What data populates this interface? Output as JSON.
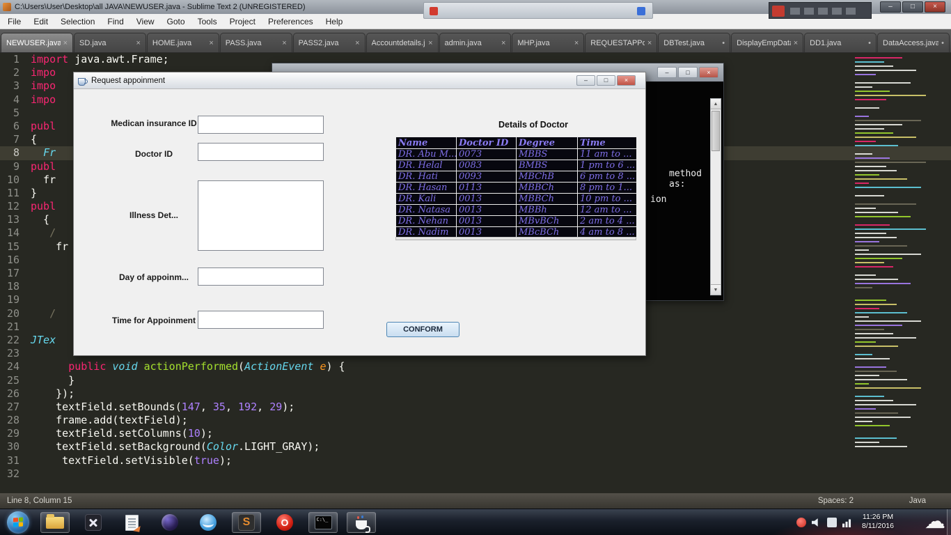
{
  "titlebar": {
    "title": "C:\\Users\\User\\Desktop\\all JAVA\\NEWUSER.java - Sublime Text 2 (UNREGISTERED)"
  },
  "glyphs": {
    "minimize": "–",
    "maximize": "□",
    "close": "×",
    "scroll_up": "▲",
    "scroll_down": "▼",
    "cloud": "☁"
  },
  "menubar": {
    "items": [
      "File",
      "Edit",
      "Selection",
      "Find",
      "View",
      "Goto",
      "Tools",
      "Project",
      "Preferences",
      "Help"
    ]
  },
  "tabs": [
    {
      "label": "NEWUSER.java",
      "indicator": "×",
      "active": true
    },
    {
      "label": "SD.java",
      "indicator": "×"
    },
    {
      "label": "HOME.java",
      "indicator": "×"
    },
    {
      "label": "PASS.java",
      "indicator": "×"
    },
    {
      "label": "PASS2.java",
      "indicator": "×"
    },
    {
      "label": "Accountdetails.jav",
      "indicator": "×"
    },
    {
      "label": "admin.java",
      "indicator": "×"
    },
    {
      "label": "MHP.java",
      "indicator": "×"
    },
    {
      "label": "REQUESTAPPoinm",
      "indicator": "×"
    },
    {
      "label": "DBTest.java",
      "indicator": "•"
    },
    {
      "label": "DisplayEmpData.j",
      "indicator": "×"
    },
    {
      "label": "DD1.java",
      "indicator": "•"
    },
    {
      "label": "DataAccess.java",
      "indicator": "•"
    }
  ],
  "editor": {
    "lines": [
      {
        "n": 1,
        "t": [
          [
            "kw",
            "import"
          ],
          [
            "pl",
            " java.awt.Frame;"
          ]
        ]
      },
      {
        "n": 2,
        "t": [
          [
            "kw",
            "impo"
          ]
        ]
      },
      {
        "n": 3,
        "t": [
          [
            "kw",
            "impo"
          ]
        ]
      },
      {
        "n": 4,
        "t": [
          [
            "kw",
            "impo"
          ]
        ]
      },
      {
        "n": 5,
        "t": []
      },
      {
        "n": 6,
        "t": [
          [
            "kw",
            "publ"
          ]
        ]
      },
      {
        "n": 7,
        "t": [
          [
            "pl",
            "{"
          ]
        ]
      },
      {
        "n": 8,
        "hl": true,
        "t": [
          [
            "pl",
            "  "
          ],
          [
            "ty",
            "Fr"
          ]
        ]
      },
      {
        "n": 9,
        "t": [
          [
            "kw",
            "publ"
          ]
        ]
      },
      {
        "n": 10,
        "t": [
          [
            "pl",
            "  fr"
          ]
        ]
      },
      {
        "n": 11,
        "t": [
          [
            "pl",
            "}"
          ]
        ]
      },
      {
        "n": 12,
        "t": [
          [
            "kw",
            "publ"
          ]
        ]
      },
      {
        "n": 13,
        "t": [
          [
            "pl",
            "  {"
          ]
        ]
      },
      {
        "n": 14,
        "t": [
          [
            "pl",
            "   "
          ],
          [
            "cm",
            "/"
          ]
        ]
      },
      {
        "n": 15,
        "t": [
          [
            "pl",
            "    fr"
          ]
        ]
      },
      {
        "n": 16,
        "t": []
      },
      {
        "n": 17,
        "t": []
      },
      {
        "n": 18,
        "t": []
      },
      {
        "n": 19,
        "t": []
      },
      {
        "n": 20,
        "t": [
          [
            "pl",
            "   "
          ],
          [
            "cm",
            "/"
          ]
        ]
      },
      {
        "n": 21,
        "t": []
      },
      {
        "n": 22,
        "t": [
          [
            "ty",
            "JTex"
          ]
        ]
      },
      {
        "n": 23,
        "t": []
      },
      {
        "n": 24,
        "t": [
          [
            "pl",
            "      "
          ],
          [
            "kw",
            "public"
          ],
          [
            "pl",
            " "
          ],
          [
            "ty",
            "void"
          ],
          [
            "pl",
            " "
          ],
          [
            "fn",
            "actionPerformed"
          ],
          [
            "pl",
            "("
          ],
          [
            "ty",
            "ActionEvent"
          ],
          [
            "pl",
            " "
          ],
          [
            "pa",
            "e"
          ],
          [
            "pl",
            ") {"
          ]
        ]
      },
      {
        "n": 25,
        "t": [
          [
            "pl",
            "      }"
          ]
        ]
      },
      {
        "n": 26,
        "t": [
          [
            "pl",
            "    });"
          ]
        ]
      },
      {
        "n": 27,
        "t": [
          [
            "pl",
            "    textField.setBounds("
          ],
          [
            "nu",
            "147"
          ],
          [
            "pl",
            ", "
          ],
          [
            "nu",
            "35"
          ],
          [
            "pl",
            ", "
          ],
          [
            "nu",
            "192"
          ],
          [
            "pl",
            ", "
          ],
          [
            "nu",
            "29"
          ],
          [
            "pl",
            ");"
          ]
        ]
      },
      {
        "n": 28,
        "t": [
          [
            "pl",
            "    frame.add(textField);"
          ]
        ]
      },
      {
        "n": 29,
        "t": [
          [
            "pl",
            "    textField.setColumns("
          ],
          [
            "nu",
            "10"
          ],
          [
            "pl",
            ");"
          ]
        ]
      },
      {
        "n": 30,
        "t": [
          [
            "pl",
            "    textField.setBackground("
          ],
          [
            "ty",
            "Color"
          ],
          [
            "pl",
            ".LIGHT_GRAY);"
          ]
        ]
      },
      {
        "n": 31,
        "t": [
          [
            "pl",
            "     textField.setVisible("
          ],
          [
            "nu",
            "true"
          ],
          [
            "pl",
            ");"
          ]
        ]
      },
      {
        "n": 32,
        "t": []
      }
    ]
  },
  "statusbar": {
    "position": "Line 8, Column 15",
    "spaces": "Spaces: 2",
    "language": "Java"
  },
  "console_window": {
    "fragment1": "method as:",
    "fragment2": "ion"
  },
  "dialog": {
    "title": "Request appoinment",
    "labels": {
      "insurance": "Medican insurance ID",
      "doctor": "Doctor ID",
      "illness": "Illness Det...",
      "day": "Day of appoinm...",
      "time": "Time for Appoinment"
    },
    "details_title": "Details of Doctor",
    "table": {
      "headers": [
        "Name",
        "Doctor ID",
        "Degree",
        "Time"
      ],
      "rows": [
        [
          "DR. Abu M...",
          "0073",
          "MBBS",
          "11 am to ..."
        ],
        [
          "DR. Helal",
          "0083",
          "BMBS",
          "1 pm to 6 ..."
        ],
        [
          "DR. Hati",
          "0093",
          "MBChB",
          "6 pm to 8 ..."
        ],
        [
          "DR. Hasan",
          "0113",
          "MBBCh",
          "8 pm to 1..."
        ],
        [
          "DR. Kali",
          "0013",
          "MBBCh",
          "10 pm to ..."
        ],
        [
          "DR. Natasa",
          "0013",
          "MBBh",
          "12 am to ..."
        ],
        [
          "DR. Nehan",
          "0013",
          "MBvBCh",
          "2 am to 4 ..."
        ],
        [
          "DR. Nadim",
          "0013",
          "MBcBCh",
          "4 am to 8 ..."
        ]
      ]
    },
    "confirm_label": "CONFORM"
  },
  "taskbar": {
    "buttons": [
      {
        "name": "explorer",
        "active": true
      },
      {
        "name": "app-x"
      },
      {
        "name": "editor-app"
      },
      {
        "name": "eclipse"
      },
      {
        "name": "blue-app"
      },
      {
        "name": "sublime",
        "glyph": "S",
        "active": true
      },
      {
        "name": "opera",
        "glyph": "O"
      },
      {
        "name": "terminal",
        "glyph": "C:\\_",
        "active": true
      },
      {
        "name": "java",
        "active": true
      }
    ],
    "tray_icons": [
      "red-status",
      "volume",
      "app",
      "network"
    ],
    "clock": {
      "time": "11:26 PM",
      "date": "8/11/2016"
    }
  }
}
